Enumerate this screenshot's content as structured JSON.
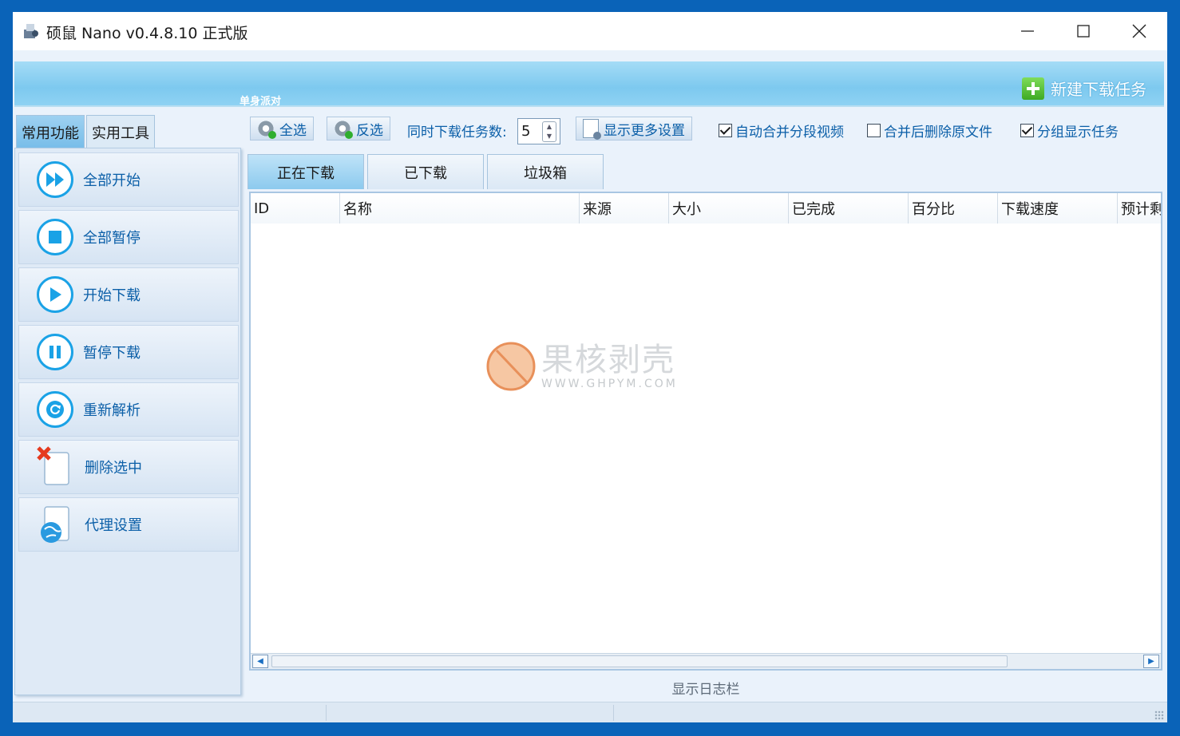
{
  "window": {
    "title": "硕鼠 Nano v0.4.8.10 正式版",
    "controls": [
      "minimize",
      "maximize",
      "close"
    ]
  },
  "banner": {
    "label": "单身派对",
    "new_task_label": "新建下载任务"
  },
  "side_tabs": [
    "常用功能",
    "实用工具"
  ],
  "side_buttons": [
    {
      "label": "全部开始",
      "icon": "fast-forward-icon"
    },
    {
      "label": "全部暂停",
      "icon": "stop-icon"
    },
    {
      "label": "开始下载",
      "icon": "play-icon"
    },
    {
      "label": "暂停下载",
      "icon": "pause-icon"
    },
    {
      "label": "重新解析",
      "icon": "refresh-icon"
    },
    {
      "label": "删除选中",
      "icon": "delete-doc-icon"
    },
    {
      "label": "代理设置",
      "icon": "globe-doc-icon"
    }
  ],
  "toolbar": {
    "select_all": "全选",
    "invert_select": "反选",
    "concurrent_label": "同时下载任务数:",
    "concurrent_value": "5",
    "more_settings": "显示更多设置",
    "auto_merge": {
      "label": "自动合并分段视频",
      "checked": true
    },
    "delete_after_merge": {
      "label": "合并后删除原文件",
      "checked": false
    },
    "group_display": {
      "label": "分组显示任务",
      "checked": true
    }
  },
  "tabs": [
    "正在下载",
    "已下载",
    "垃圾箱"
  ],
  "columns": [
    "ID",
    "名称",
    "来源",
    "大小",
    "已完成",
    "百分比",
    "下载速度",
    "预计剩"
  ],
  "watermark": {
    "main": "果核剥壳",
    "sub": "WWW.GHPYM.COM"
  },
  "log_toggle": "显示日志栏",
  "colors": {
    "accent_blue": "#1aa2e6",
    "label_blue": "#0b5fa8",
    "banner": "#8fd2f3",
    "new_task_green": "#3eaa23"
  }
}
